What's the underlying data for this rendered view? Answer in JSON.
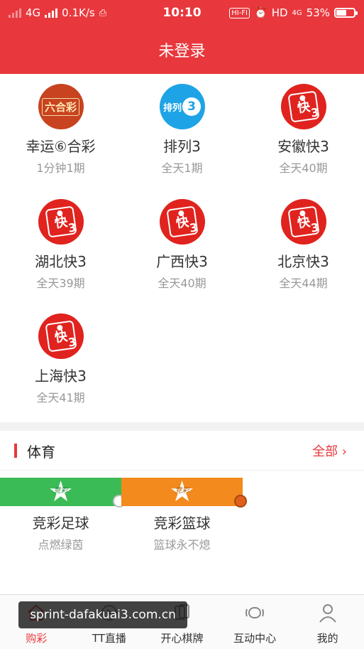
{
  "status_bar": {
    "network": "4G",
    "speed": "0.1K/s",
    "time": "10:10",
    "hifi": "HI-FI",
    "hd": "HD",
    "net2": "4G",
    "battery": "53%"
  },
  "header": {
    "title": "未登录"
  },
  "lotteries": [
    {
      "name": "幸运⑥合彩",
      "sub": "1分钟1期",
      "logo_text": "六合彩",
      "icon": "liuhecai-logo-icon"
    },
    {
      "name": "排列3",
      "sub": "全天1期",
      "logo_text": "排列",
      "logo_num": "3",
      "icon": "pailie3-logo-icon"
    },
    {
      "name": "安徽快3",
      "sub": "全天40期",
      "logo_text": "快",
      "logo_num": "3",
      "icon": "kuai3-logo-icon"
    },
    {
      "name": "湖北快3",
      "sub": "全天39期",
      "logo_text": "快",
      "logo_num": "3",
      "icon": "kuai3-logo-icon"
    },
    {
      "name": "广西快3",
      "sub": "全天40期",
      "logo_text": "快",
      "logo_num": "3",
      "icon": "kuai3-logo-icon"
    },
    {
      "name": "北京快3",
      "sub": "全天44期",
      "logo_text": "快",
      "logo_num": "3",
      "icon": "kuai3-logo-icon"
    },
    {
      "name": "上海快3",
      "sub": "全天41期",
      "logo_text": "快",
      "logo_num": "3",
      "icon": "kuai3-logo-icon"
    }
  ],
  "sports": {
    "title": "体育",
    "more": "全部 ›",
    "items": [
      {
        "name": "竞彩足球",
        "sub": "点燃绿茵",
        "logo_text": "竞彩",
        "icon": "football-logo-icon"
      },
      {
        "name": "竞彩篮球",
        "sub": "篮球永不熄",
        "logo_text": "竞彩",
        "icon": "basketball-logo-icon"
      }
    ]
  },
  "tabs": [
    {
      "label": "购彩",
      "icon": "home-icon",
      "active": true
    },
    {
      "label": "TT直播",
      "icon": "live-icon",
      "active": false
    },
    {
      "label": "开心棋牌",
      "icon": "cards-icon",
      "active": false
    },
    {
      "label": "互动中心",
      "icon": "chat-icon",
      "active": false
    },
    {
      "label": "我的",
      "icon": "user-icon",
      "active": false
    }
  ],
  "watermark": "sprint-dafakuai3.com.cn",
  "colors": {
    "accent": "#e8383d",
    "green": "#3bbb55",
    "orange": "#f28a1d",
    "blue": "#1ea3e6"
  }
}
